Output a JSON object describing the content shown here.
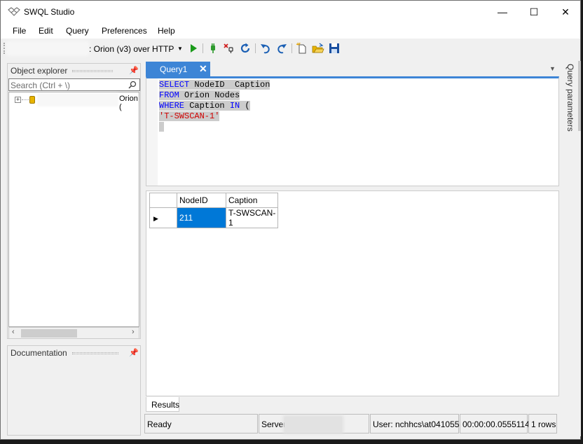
{
  "window": {
    "title": "SWQL Studio",
    "controls": {
      "minimize": "—",
      "maximize": "☐",
      "close": "✕"
    }
  },
  "menu": [
    "File",
    "Edit",
    "Query",
    "Preferences",
    "Help"
  ],
  "toolbar": {
    "connection_label": ": Orion (v3) over HTTP"
  },
  "object_explorer": {
    "title": "Object explorer",
    "search_placeholder": "Search (Ctrl + \\)",
    "tree_node_label": "Orion ("
  },
  "documentation": {
    "title": "Documentation"
  },
  "tab": {
    "label": "Query1"
  },
  "query": {
    "lines": [
      [
        {
          "t": "SELECT",
          "c": "kw"
        },
        {
          "t": " NodeID  Caption",
          "c": ""
        }
      ],
      [
        {
          "t": "FROM",
          "c": "kw"
        },
        {
          "t": " Orion Nodes",
          "c": ""
        }
      ],
      [
        {
          "t": "WHERE",
          "c": "kw"
        },
        {
          "t": " Caption ",
          "c": ""
        },
        {
          "t": "IN",
          "c": "kw"
        },
        {
          "t": " (",
          "c": ""
        }
      ],
      [
        {
          "t": "'T-SWSCAN-1'",
          "c": "str"
        }
      ],
      [
        {
          "t": " ",
          "c": ""
        }
      ]
    ]
  },
  "results": {
    "columns": [
      "NodeID",
      "Caption"
    ],
    "rows": [
      [
        "211",
        "T-SWSCAN-1"
      ]
    ],
    "tab_label": "Results"
  },
  "status": {
    "state": "Ready",
    "server_label": "Server:",
    "user": "User: nchhcs\\at041055",
    "duration": "00:00:00.0555114",
    "rows": "1 rows"
  },
  "query_parameters": {
    "label": "Query parameters"
  }
}
